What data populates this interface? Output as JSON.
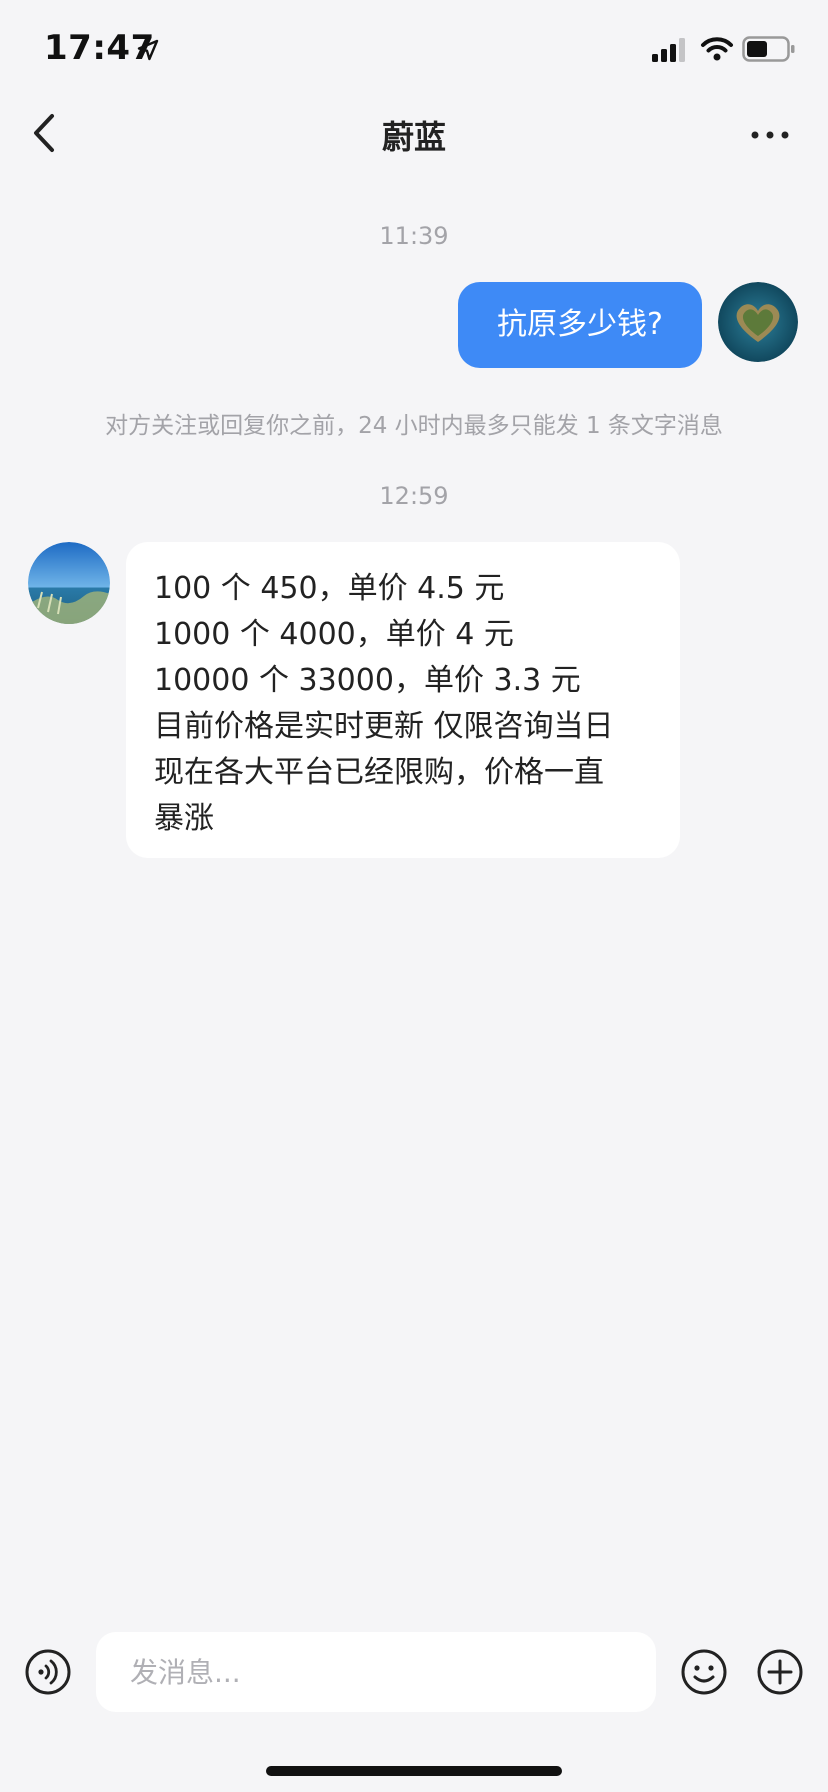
{
  "status_bar": {
    "time": "17:47",
    "icons": [
      "location-arrow-icon",
      "signal-icon",
      "wifi-icon",
      "battery-icon"
    ]
  },
  "header": {
    "title": "蔚蓝",
    "back_icon": "chevron-left-icon",
    "more_icon": "more-dots-icon"
  },
  "chat": {
    "timestamp_1": "11:39",
    "outgoing_message": "抗原多少钱?",
    "system_notice": "对方关注或回复你之前，24 小时内最多只能发 1 条文字消息",
    "timestamp_2": "12:59",
    "incoming_message": {
      "line_1": "100 个 450，单价 4.5 元",
      "line_2": "1000 个 4000，单价 4 元",
      "line_3": "10000 个 33000，单价 3.3 元",
      "line_4": "目前价格是实时更新 仅限咨询当日",
      "line_5": "现在各大平台已经限购，价格一直",
      "line_6": "暴涨"
    }
  },
  "input_bar": {
    "placeholder": "发消息...",
    "value": "",
    "icons": [
      "voice-icon",
      "emoji-icon",
      "plus-icon"
    ]
  },
  "colors": {
    "background": "#f5f5f7",
    "outgoing_bubble": "#3e8af6",
    "incoming_bubble": "#ffffff",
    "secondary_text": "#a3a3a8"
  }
}
